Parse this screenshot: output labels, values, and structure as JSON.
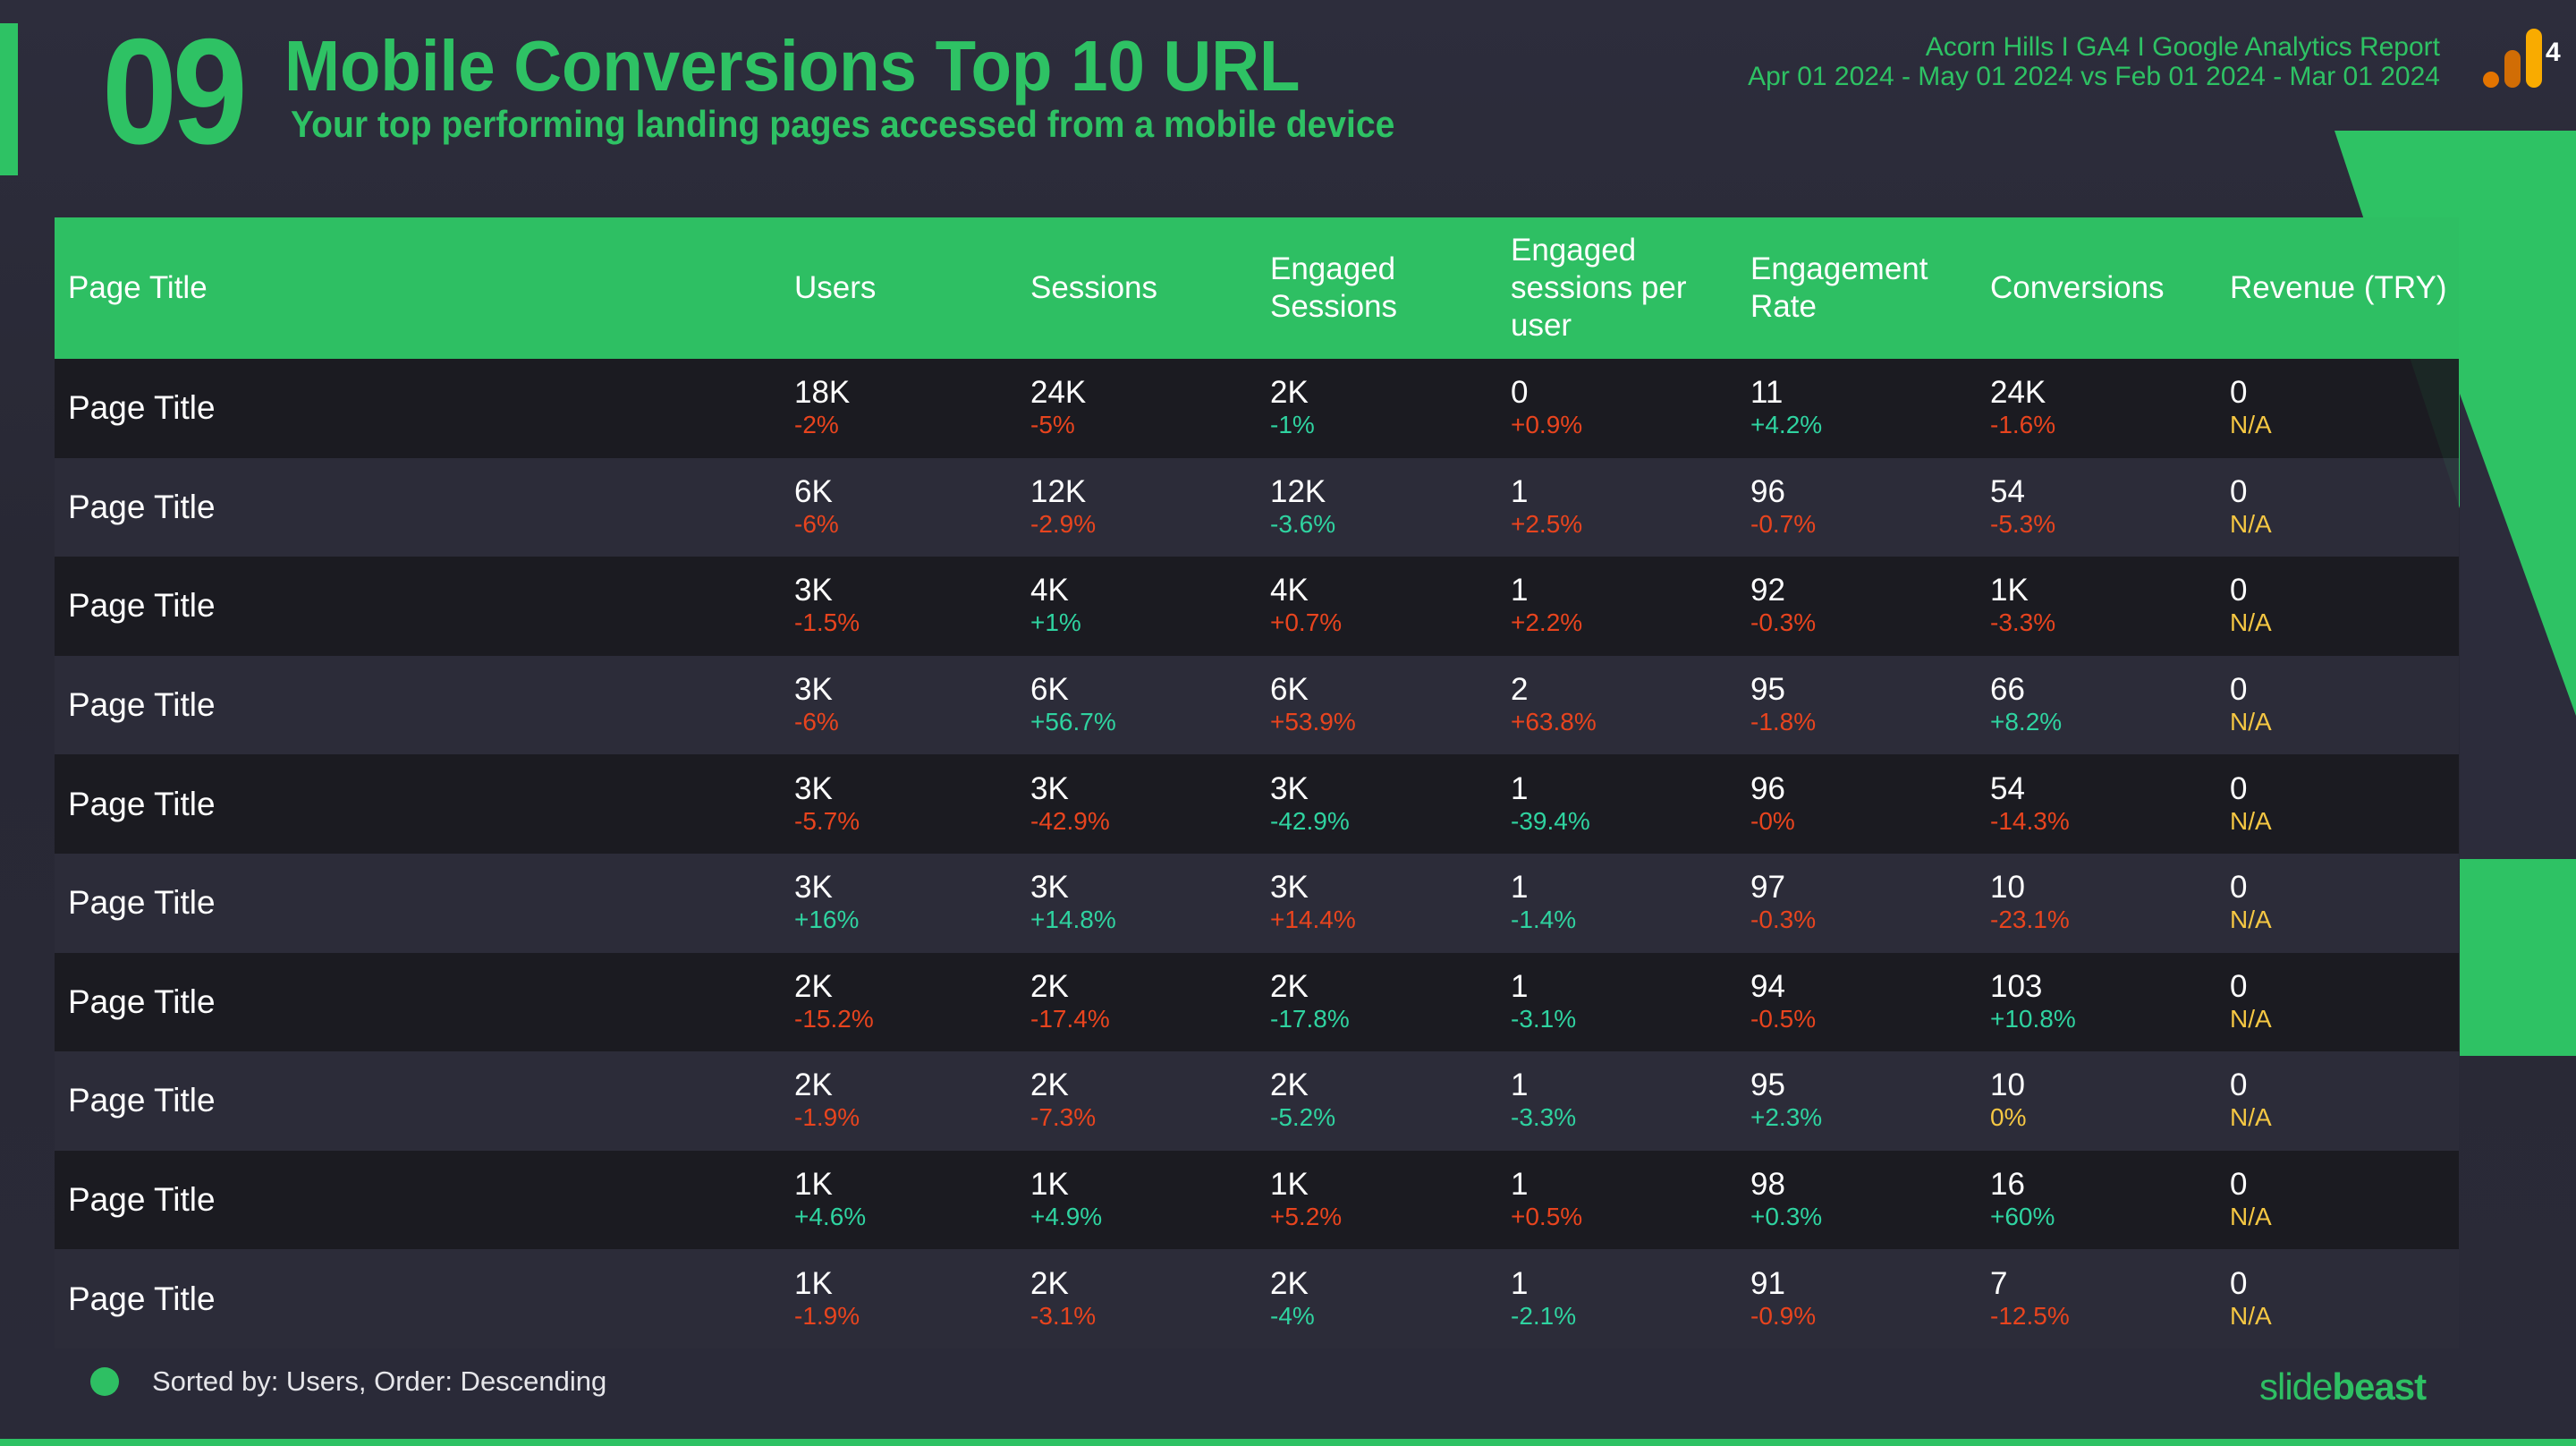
{
  "header": {
    "section_number": "09",
    "title": "Mobile Conversions Top 10 URL",
    "subtitle": "Your top performing landing pages accessed from a mobile device",
    "report_name": "Acorn Hills I GA4 I Google Analytics Report",
    "date_range": "Apr 01 2024 - May 01 2024 vs Feb 01 2024 - Mar 01 2024",
    "logo_icon": "google-analytics-4-icon",
    "logo_suffix": "4"
  },
  "colors": {
    "accent": "#2ec264",
    "good": "#2fd3a0",
    "bad": "#e8441e",
    "neutral": "#f5c743",
    "background": "#2c2c3b"
  },
  "table": {
    "columns": [
      "Page Title",
      "Users",
      "Sessions",
      "Engaged Sessions",
      "Engaged sessions per user",
      "Engagement Rate",
      "Conversions",
      "Revenue (TRY)"
    ],
    "rows": [
      {
        "title": "Page Title",
        "cells": [
          [
            "18K",
            "-2%",
            "bad"
          ],
          [
            "24K",
            "-5%",
            "bad"
          ],
          [
            "2K",
            "-1%",
            "good"
          ],
          [
            "0",
            "+0.9%",
            "bad"
          ],
          [
            "11",
            "+4.2%",
            "good"
          ],
          [
            "24K",
            "-1.6%",
            "bad"
          ],
          [
            "0",
            "N/A",
            "neutral"
          ]
        ]
      },
      {
        "title": "Page Title",
        "cells": [
          [
            "6K",
            "-6%",
            "bad"
          ],
          [
            "12K",
            "-2.9%",
            "bad"
          ],
          [
            "12K",
            "-3.6%",
            "good"
          ],
          [
            "1",
            "+2.5%",
            "bad"
          ],
          [
            "96",
            "-0.7%",
            "bad"
          ],
          [
            "54",
            "-5.3%",
            "bad"
          ],
          [
            "0",
            "N/A",
            "neutral"
          ]
        ]
      },
      {
        "title": "Page Title",
        "cells": [
          [
            "3K",
            "-1.5%",
            "bad"
          ],
          [
            "4K",
            "+1%",
            "good"
          ],
          [
            "4K",
            "+0.7%",
            "bad"
          ],
          [
            "1",
            "+2.2%",
            "bad"
          ],
          [
            "92",
            "-0.3%",
            "bad"
          ],
          [
            "1K",
            "-3.3%",
            "bad"
          ],
          [
            "0",
            "N/A",
            "neutral"
          ]
        ]
      },
      {
        "title": "Page Title",
        "cells": [
          [
            "3K",
            "-6%",
            "bad"
          ],
          [
            "6K",
            "+56.7%",
            "good"
          ],
          [
            "6K",
            "+53.9%",
            "bad"
          ],
          [
            "2",
            "+63.8%",
            "bad"
          ],
          [
            "95",
            "-1.8%",
            "bad"
          ],
          [
            "66",
            "+8.2%",
            "good"
          ],
          [
            "0",
            "N/A",
            "neutral"
          ]
        ]
      },
      {
        "title": "Page Title",
        "cells": [
          [
            "3K",
            "-5.7%",
            "bad"
          ],
          [
            "3K",
            "-42.9%",
            "bad"
          ],
          [
            "3K",
            "-42.9%",
            "good"
          ],
          [
            "1",
            "-39.4%",
            "good"
          ],
          [
            "96",
            "-0%",
            "bad"
          ],
          [
            "54",
            "-14.3%",
            "bad"
          ],
          [
            "0",
            "N/A",
            "neutral"
          ]
        ]
      },
      {
        "title": "Page Title",
        "cells": [
          [
            "3K",
            "+16%",
            "good"
          ],
          [
            "3K",
            "+14.8%",
            "good"
          ],
          [
            "3K",
            "+14.4%",
            "bad"
          ],
          [
            "1",
            "-1.4%",
            "good"
          ],
          [
            "97",
            "-0.3%",
            "bad"
          ],
          [
            "10",
            "-23.1%",
            "bad"
          ],
          [
            "0",
            "N/A",
            "neutral"
          ]
        ]
      },
      {
        "title": "Page Title",
        "cells": [
          [
            "2K",
            "-15.2%",
            "bad"
          ],
          [
            "2K",
            "-17.4%",
            "bad"
          ],
          [
            "2K",
            "-17.8%",
            "good"
          ],
          [
            "1",
            "-3.1%",
            "good"
          ],
          [
            "94",
            "-0.5%",
            "bad"
          ],
          [
            "103",
            "+10.8%",
            "good"
          ],
          [
            "0",
            "N/A",
            "neutral"
          ]
        ]
      },
      {
        "title": "Page Title",
        "cells": [
          [
            "2K",
            "-1.9%",
            "bad"
          ],
          [
            "2K",
            "-7.3%",
            "bad"
          ],
          [
            "2K",
            "-5.2%",
            "good"
          ],
          [
            "1",
            "-3.3%",
            "good"
          ],
          [
            "95",
            "+2.3%",
            "good"
          ],
          [
            "10",
            "0%",
            "neutral"
          ],
          [
            "0",
            "N/A",
            "neutral"
          ]
        ]
      },
      {
        "title": "Page Title",
        "cells": [
          [
            "1K",
            "+4.6%",
            "good"
          ],
          [
            "1K",
            "+4.9%",
            "good"
          ],
          [
            "1K",
            "+5.2%",
            "bad"
          ],
          [
            "1",
            "+0.5%",
            "bad"
          ],
          [
            "98",
            "+0.3%",
            "good"
          ],
          [
            "16",
            "+60%",
            "good"
          ],
          [
            "0",
            "N/A",
            "neutral"
          ]
        ]
      },
      {
        "title": "Page Title",
        "cells": [
          [
            "1K",
            "-1.9%",
            "bad"
          ],
          [
            "2K",
            "-3.1%",
            "bad"
          ],
          [
            "2K",
            "-4%",
            "good"
          ],
          [
            "1",
            "-2.1%",
            "good"
          ],
          [
            "91",
            "-0.9%",
            "bad"
          ],
          [
            "7",
            "-12.5%",
            "bad"
          ],
          [
            "0",
            "N/A",
            "neutral"
          ]
        ]
      }
    ]
  },
  "footer": {
    "sort_note": "Sorted by: Users, Order: Descending",
    "brand_light": "slide",
    "brand_bold": "beast"
  }
}
